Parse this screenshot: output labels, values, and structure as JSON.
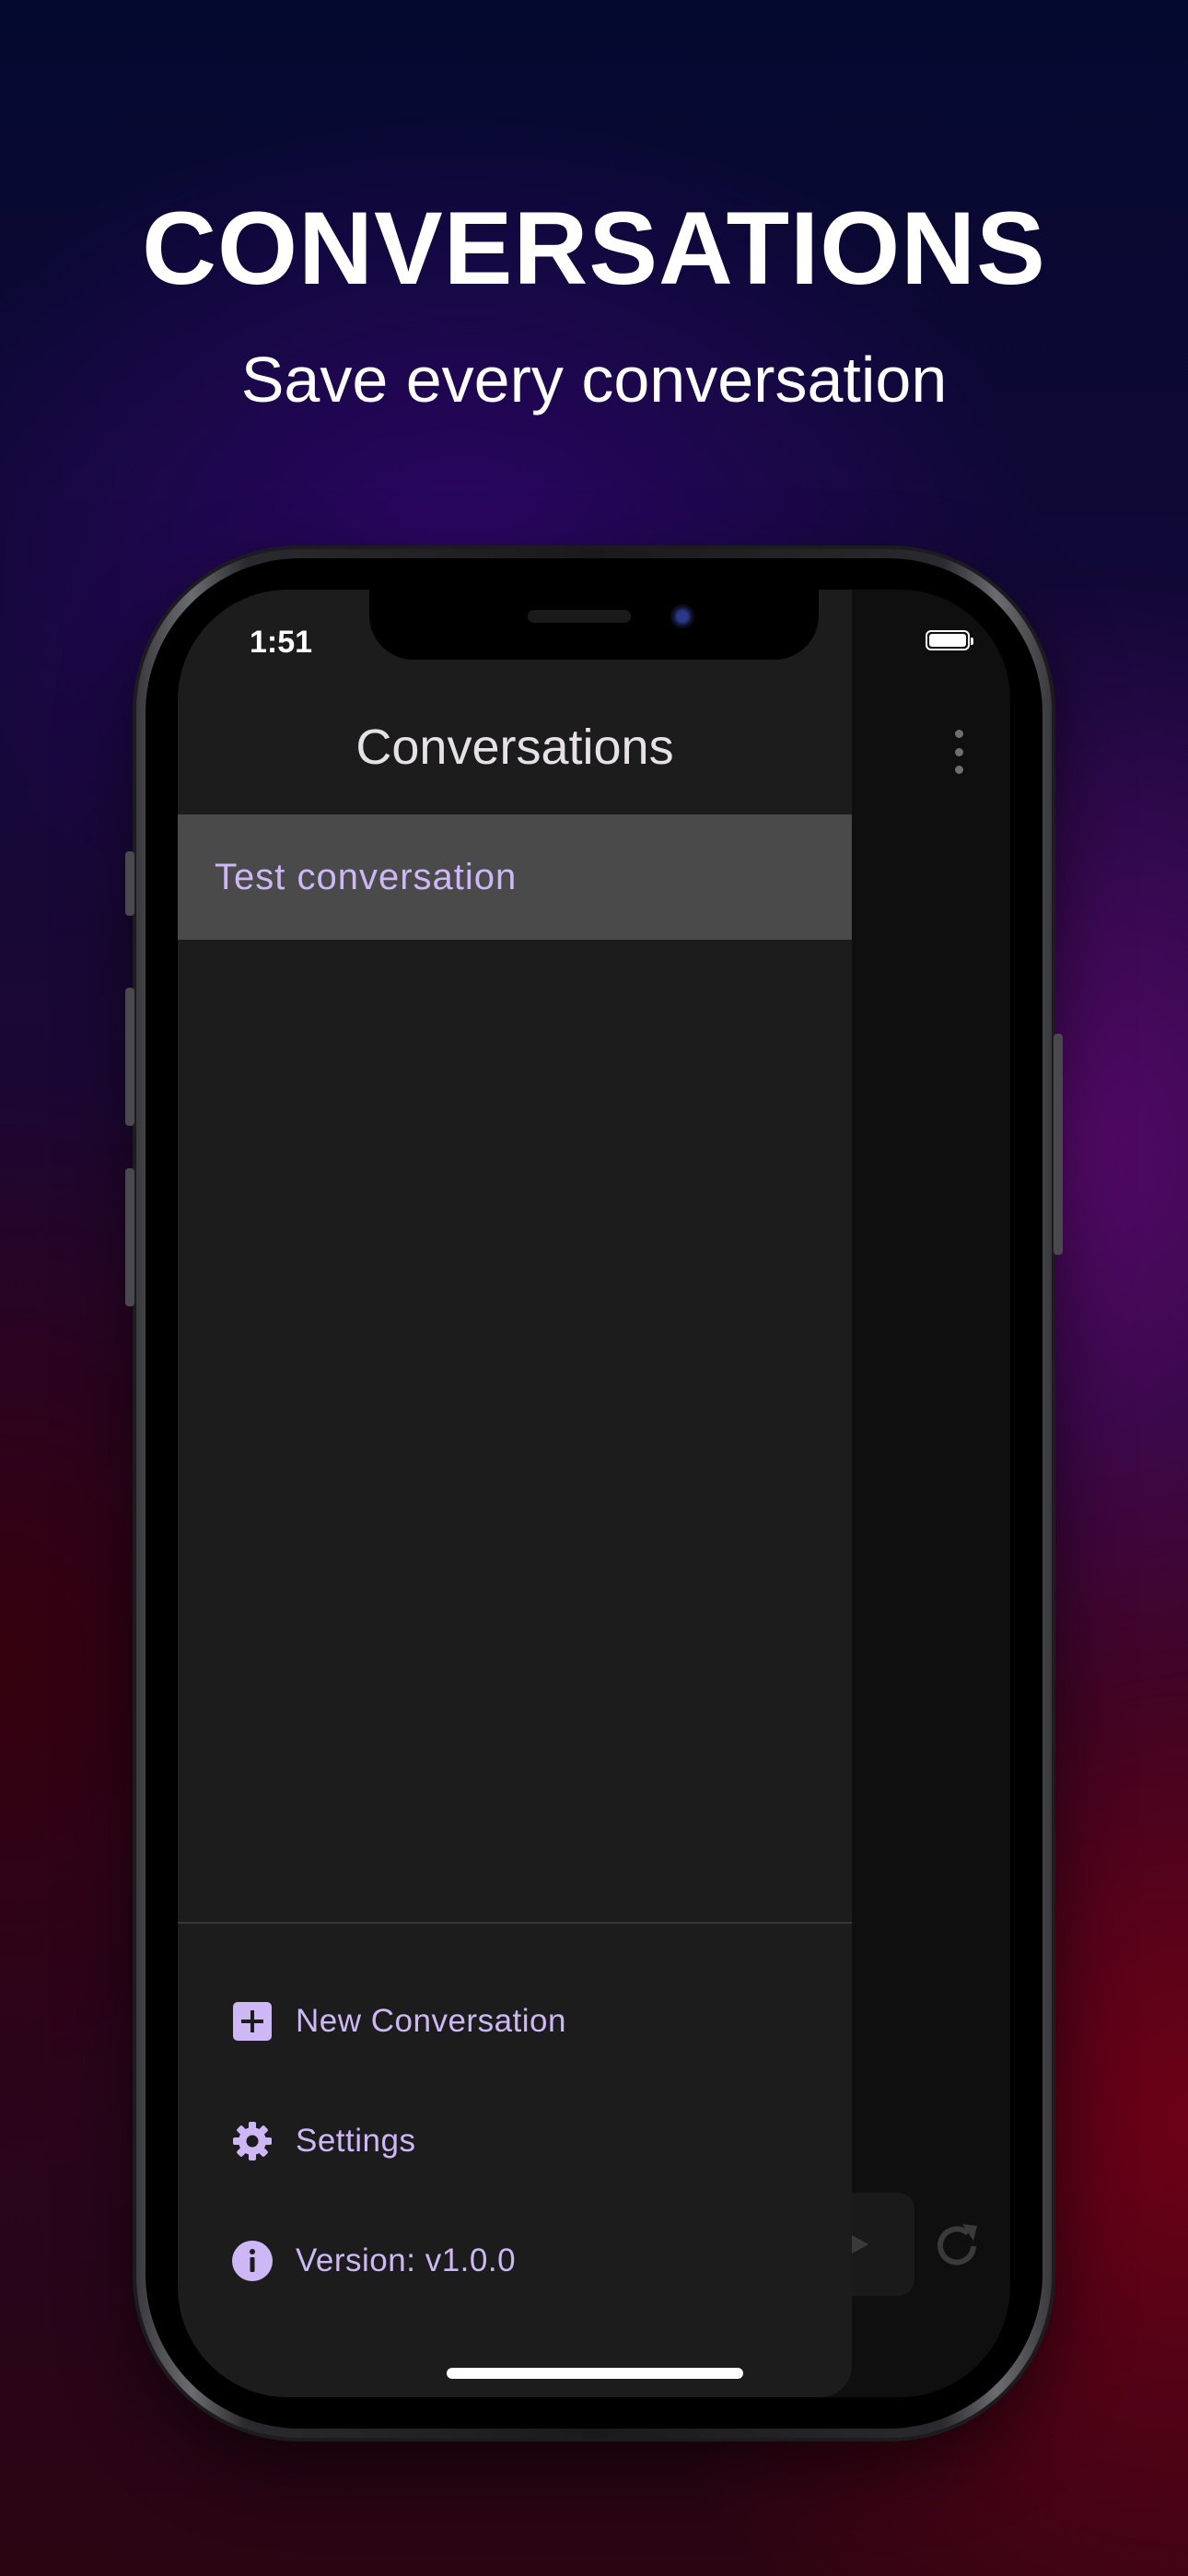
{
  "hero": {
    "title": "CONVERSATIONS",
    "subtitle": "Save every conversation"
  },
  "status_bar": {
    "time": "1:51",
    "battery_level": 1.0
  },
  "drawer": {
    "title": "Conversations",
    "conversations": [
      {
        "label": "Test conversation",
        "selected": true
      }
    ],
    "actions": {
      "new_conversation": {
        "label": "New Conversation",
        "icon": "plus-square-icon"
      },
      "settings": {
        "label": "Settings",
        "icon": "gear-icon"
      },
      "version": {
        "label": "Version: v1.0.0",
        "icon": "info-icon"
      }
    }
  },
  "background_app": {
    "menu_icon": "more-vert-icon",
    "send_icon": "send-icon",
    "refresh_icon": "refresh-icon"
  },
  "colors": {
    "accent": "#cdb8f5",
    "drawer_bg": "#1c1c1d",
    "selected_item_bg": "#4a4a4b"
  }
}
